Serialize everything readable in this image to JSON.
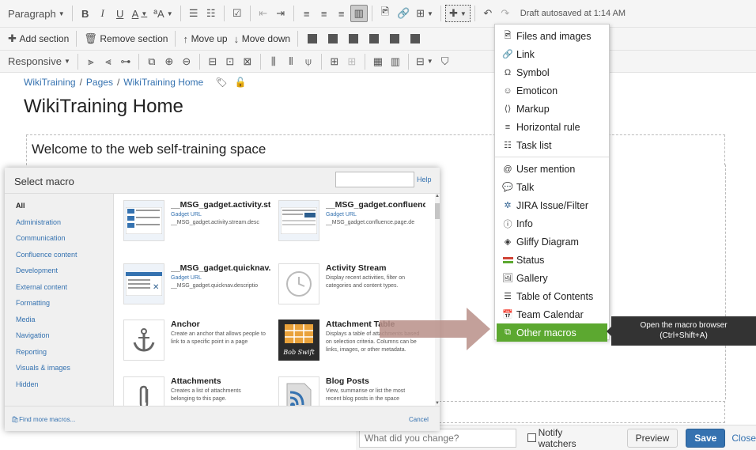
{
  "toolbar": {
    "paragraph_label": "Paragraph",
    "autosave_text": "Draft autosaved at 1:14 AM"
  },
  "toolbar2": {
    "add_section": "Add section",
    "remove_section": "Remove section",
    "move_up": "Move up",
    "move_down": "Move down"
  },
  "toolbar3": {
    "responsive_label": "Responsive"
  },
  "breadcrumb": [
    "WikiTraining",
    "Pages",
    "WikiTraining Home"
  ],
  "page_title": "WikiTraining Home",
  "content_heading": "Welcome to the web self-training space",
  "macro_dialog": {
    "title": "Select macro",
    "help": "Help",
    "categories": [
      "All",
      "Administration",
      "Communication",
      "Confluence content",
      "Development",
      "External content",
      "Formatting",
      "Media",
      "Navigation",
      "Reporting",
      "Visuals & images",
      "Hidden"
    ],
    "macros": [
      {
        "title": "__MSG_gadget.activity.stre",
        "url": "Gadget URL",
        "desc": "__MSG_gadget.activity.stream.desc"
      },
      {
        "title": "__MSG_gadget.confluence",
        "url": "Gadget URL",
        "desc": "__MSG_gadget.confluence.page.de"
      },
      {
        "title": "__MSG_gadget.quicknav.ti",
        "url": "Gadget URL",
        "desc": "__MSG_gadget.quicknav.descriptio"
      },
      {
        "title": "Activity Stream",
        "url": "",
        "desc": "Display recent activities, filter on categories and content types."
      },
      {
        "title": "Anchor",
        "url": "",
        "desc": "Create an anchor that allows people to link to a specific point in a page"
      },
      {
        "title": "Attachment Table",
        "url": "",
        "desc": "Displays a table of attachments based on selection criteria. Columns can be links, images, or other metadata."
      },
      {
        "title": "Attachments",
        "url": "",
        "desc": "Creates a list of attachments belonging to this page."
      },
      {
        "title": "Blog Posts",
        "url": "",
        "desc": "View, summarise or list the most recent blog posts in the space"
      }
    ],
    "bob_swift": "Bob Swift",
    "find_more": "Find more macros...",
    "cancel": "Cancel"
  },
  "insert_menu": {
    "items": [
      {
        "label": "Files and images",
        "icon": "image-icon"
      },
      {
        "label": "Link",
        "icon": "link-icon"
      },
      {
        "label": "Symbol",
        "icon": "omega-icon"
      },
      {
        "label": "Emoticon",
        "icon": "smiley-icon"
      },
      {
        "label": "Markup",
        "icon": "markup-icon"
      },
      {
        "label": "Horizontal rule",
        "icon": "hr-icon"
      },
      {
        "label": "Task list",
        "icon": "task-list-icon"
      },
      {
        "label": "User mention",
        "icon": "at-icon"
      },
      {
        "label": "Talk",
        "icon": "talk-icon"
      },
      {
        "label": "JIRA Issue/Filter",
        "icon": "jira-icon"
      },
      {
        "label": "Info",
        "icon": "info-icon"
      },
      {
        "label": "Gliffy Diagram",
        "icon": "gliffy-icon"
      },
      {
        "label": "Status",
        "icon": "status-icon"
      },
      {
        "label": "Gallery",
        "icon": "gallery-icon"
      },
      {
        "label": "Table of Contents",
        "icon": "toc-icon"
      },
      {
        "label": "Team Calendar",
        "icon": "calendar-icon"
      },
      {
        "label": "Other macros",
        "icon": "macros-icon"
      }
    ]
  },
  "tooltip": {
    "line1": "Open the macro browser",
    "line2": "(Ctrl+Shift+A)"
  },
  "footer": {
    "change_placeholder": "What did you change?",
    "notify_label": "Notify watchers",
    "preview": "Preview",
    "save": "Save",
    "close": "Close"
  },
  "colors": {
    "accent": "#5ca830",
    "link": "#3572b0",
    "save": "#3572b0",
    "callout": "#b98f88"
  }
}
